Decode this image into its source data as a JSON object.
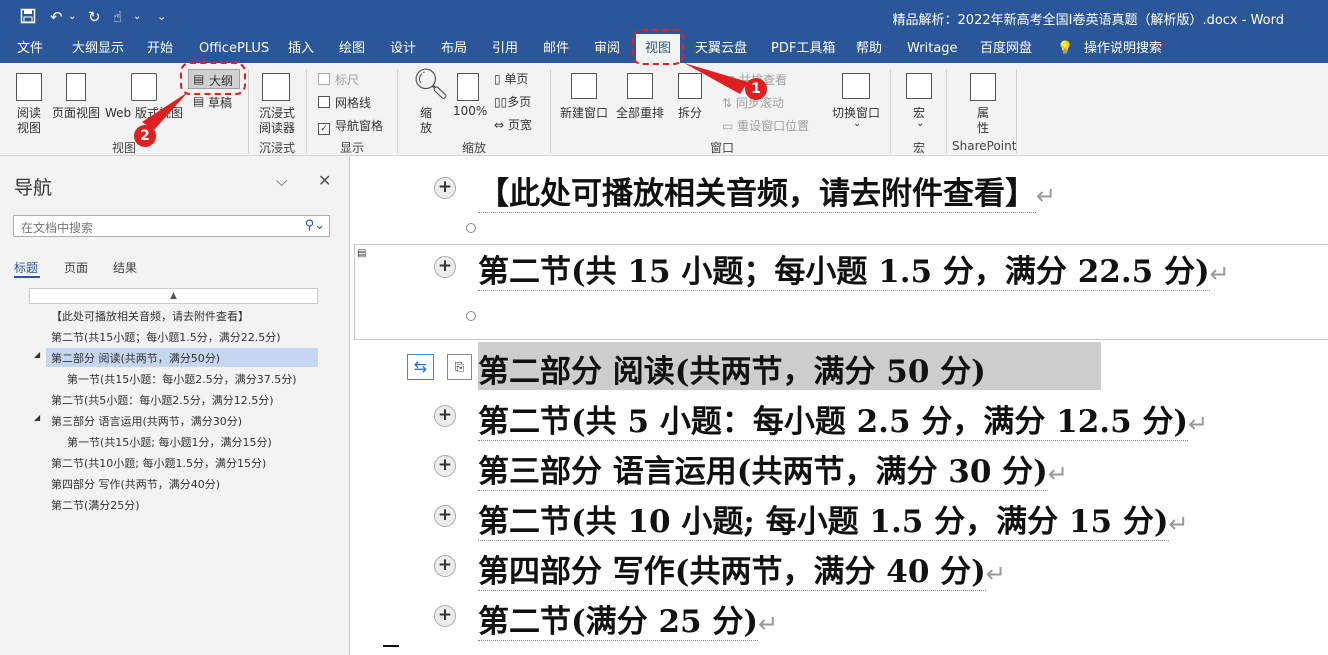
{
  "window": {
    "title": "精品解析：2022年新高考全国Ⅰ卷英语真题（解析版）.docx - Word"
  },
  "quick_access": {
    "save_icon": "save-icon",
    "undo_icon": "undo-icon",
    "redo_icon": "redo-icon",
    "touch_icon": "touch-mode-icon",
    "customize": "⌄"
  },
  "menu": {
    "tabs": [
      {
        "label": "文件"
      },
      {
        "label": "大纲显示"
      },
      {
        "label": "开始"
      },
      {
        "label": "OfficePLUS"
      },
      {
        "label": "插入"
      },
      {
        "label": "绘图"
      },
      {
        "label": "设计"
      },
      {
        "label": "布局"
      },
      {
        "label": "引用"
      },
      {
        "label": "邮件"
      },
      {
        "label": "审阅"
      },
      {
        "label": "视图"
      },
      {
        "label": "天翼云盘"
      },
      {
        "label": "PDF工具箱"
      },
      {
        "label": "帮助"
      },
      {
        "label": "Writage"
      },
      {
        "label": "百度网盘"
      }
    ],
    "active_tab": "视图",
    "tell_me": "操作说明搜索"
  },
  "ribbon": {
    "view": {
      "read_mode": "阅读视图",
      "read_mode_l1": "阅读",
      "read_mode_l2": "视图",
      "print_layout": "页面视图",
      "web_layout": "Web 版式视图",
      "outline": "大纲",
      "draft": "草稿",
      "group": "视图"
    },
    "immersive": {
      "reader_l1": "沉浸式",
      "reader_l2": "阅读器",
      "group": "沉浸式"
    },
    "show": {
      "ruler": "标尺",
      "gridlines": "网格线",
      "nav_pane": "导航窗格",
      "ruler_checked": false,
      "gridlines_checked": false,
      "nav_pane_checked": true,
      "group": "显示"
    },
    "zoom": {
      "zoom_l1": "缩",
      "zoom_l2": "放",
      "hundred": "100%",
      "one_page": "单页",
      "multi_page": "多页",
      "page_width": "页宽",
      "group": "缩放"
    },
    "window": {
      "new_window": "新建窗口",
      "arrange_all": "全部重排",
      "split": "拆分",
      "side_by_side": "并排查看",
      "sync_scroll": "同步滚动",
      "reset_position": "重设窗口位置",
      "switch_windows": "切换窗口",
      "group": "窗口"
    },
    "macros": {
      "label": "宏",
      "group": "宏"
    },
    "sharepoint": {
      "props_l1": "属",
      "props_l2": "性",
      "group": "SharePoint"
    }
  },
  "annotations": {
    "badge1": "1",
    "badge2": "2"
  },
  "nav_pane": {
    "title": "导航",
    "search_placeholder": "在文档中搜索",
    "tabs": [
      "标题",
      "页面",
      "结果"
    ],
    "active_tab": "标题",
    "items": [
      {
        "text": "【此处可播放相关音频，请去附件查看】"
      },
      {
        "text": "第二节(共15小题；每小题1.5分，满分22.5分)"
      },
      {
        "text": "第二部分 阅读(共两节，满分50分)",
        "expanded": true,
        "selected": true
      },
      {
        "text": "第一节(共15小题：每小题2.5分，满分37.5分)"
      },
      {
        "text": "第二节(共5小题：每小题2.5分，满分12.5分)"
      },
      {
        "text": "第三部分 语言运用(共两节，满分30分)",
        "expanded": true
      },
      {
        "text": "第一节(共15小题; 每小题1分，满分15分)"
      },
      {
        "text": "第二节(共10小题; 每小题1.5分，满分15分)"
      },
      {
        "text": "第四部分 写作(共两节，满分40分)"
      },
      {
        "text": "第二节(满分25分)"
      }
    ]
  },
  "document": {
    "lines": [
      {
        "text": "【此处可播放相关音频，请去附件查看】"
      },
      {
        "text": "第二节(共 15 小题；每小题 1.5 分，满分 22.5 分)"
      },
      {
        "text": "第二部分  阅读(共两节，满分 50 分)"
      },
      {
        "text": "第二节(共 5 小题：每小题 2.5 分，满分 12.5 分)"
      },
      {
        "text": "第三部分  语言运用(共两节，满分 30 分)"
      },
      {
        "text": "第二节(共 10 小题; 每小题 1.5 分，满分 15 分)"
      },
      {
        "text": "第四部分  写作(共两节，满分 40 分)"
      },
      {
        "text": "第二节(满分 25 分)"
      }
    ],
    "pilcrow": "↵"
  }
}
